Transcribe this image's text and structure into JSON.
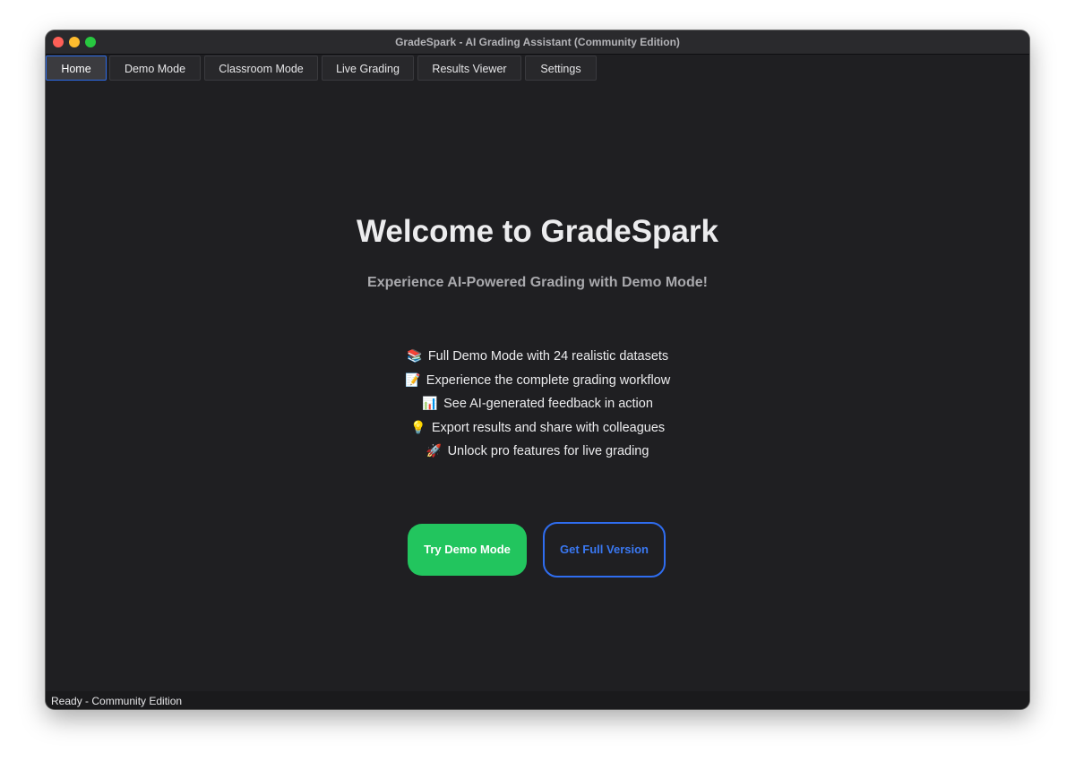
{
  "window": {
    "title": "GradeSpark - AI Grading Assistant (Community Edition)"
  },
  "tabs": [
    {
      "label": "Home",
      "active": true
    },
    {
      "label": "Demo Mode",
      "active": false
    },
    {
      "label": "Classroom Mode",
      "active": false
    },
    {
      "label": "Live Grading",
      "active": false
    },
    {
      "label": "Results Viewer",
      "active": false
    },
    {
      "label": "Settings",
      "active": false
    }
  ],
  "home": {
    "heading": "Welcome to GradeSpark",
    "subheading": "Experience AI-Powered Grading with Demo Mode!",
    "features": [
      {
        "emoji": "📚",
        "icon": "books-icon",
        "text": "Full Demo Mode with 24 realistic datasets"
      },
      {
        "emoji": "📝",
        "icon": "memo-icon",
        "text": "Experience the complete grading workflow"
      },
      {
        "emoji": "📊",
        "icon": "bar-chart-icon",
        "text": "See AI-generated feedback in action"
      },
      {
        "emoji": "💡",
        "icon": "lightbulb-icon",
        "text": "Export results and share with colleagues"
      },
      {
        "emoji": "🚀",
        "icon": "rocket-icon",
        "text": "Unlock pro features for live grading"
      }
    ],
    "primary_button": "Try Demo Mode",
    "secondary_button": "Get Full Version"
  },
  "status": {
    "text": "Ready - Community Edition"
  },
  "colors": {
    "background": "#1f1f22",
    "accent_green": "#22c55e",
    "accent_blue": "#2f6df0",
    "traffic_close": "#fe5f57",
    "traffic_minimize": "#febc2e",
    "traffic_maximize": "#28c840"
  }
}
